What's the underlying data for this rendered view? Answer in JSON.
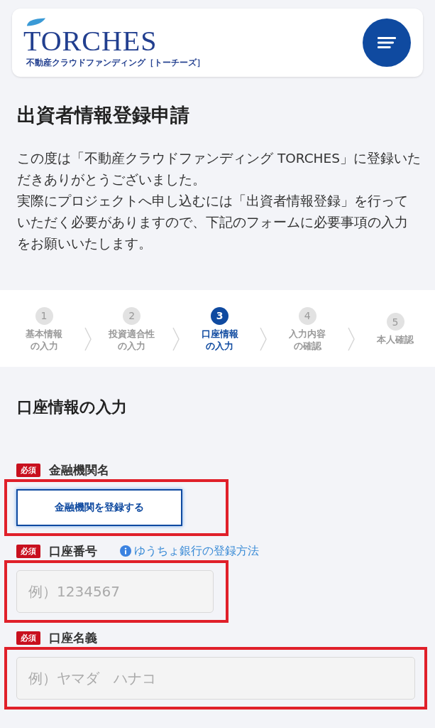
{
  "header": {
    "logo": "TORCHES",
    "tagline": "不動産クラウドファンディング［トーチーズ］"
  },
  "title": "出資者情報登録申請",
  "intro": [
    "この度は「不動産クラウドファンディング TORCHES」に登録いただきありがとうございました。",
    "実際にプロジェクトへ申し込むには「出資者情報登録」を行っていただく必要がありますので、下記のフォームに必要事項の入力をお願いいたします。"
  ],
  "steps": [
    {
      "number": "1",
      "label_lines": [
        "基本情報",
        "の入力"
      ],
      "selected": false
    },
    {
      "number": "2",
      "label_lines": [
        "投資適合性",
        "の入力"
      ],
      "selected": false
    },
    {
      "number": "3",
      "label_lines": [
        "口座情報",
        "の入力"
      ],
      "selected": true
    },
    {
      "number": "4",
      "label_lines": [
        "入力内容",
        "の確認"
      ],
      "selected": false
    },
    {
      "number": "5",
      "label_lines": [
        "本人確認"
      ],
      "selected": false
    }
  ],
  "section_title": "口座情報の入力",
  "fields": [
    {
      "kind": "button",
      "badge": "必須",
      "label": "金融機関名",
      "button": "金融機関を登録する",
      "highlighted": true
    },
    {
      "kind": "input",
      "badge": "必須",
      "label": "口座番号",
      "help_link": "ゆうちょ銀行の登録方法",
      "placeholder": "例）1234567",
      "highlighted": true
    },
    {
      "kind": "wide-input",
      "badge": "必須",
      "label": "口座名義",
      "placeholder": "例）ヤマダ　ハナコ",
      "highlighted": true
    }
  ]
}
